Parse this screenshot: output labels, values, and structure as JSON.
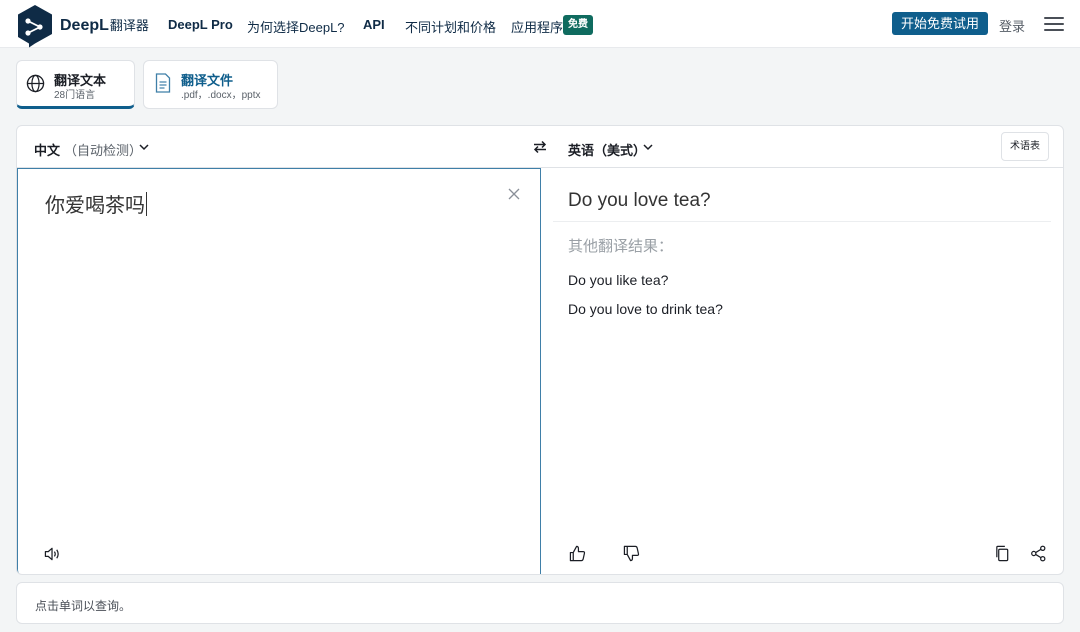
{
  "header": {
    "brand": "DeepL",
    "brand_sub": "翻译器",
    "nav": [
      "DeepL Pro",
      "为何选择DeepL?",
      "API",
      "不同计划和价格",
      "应用程序"
    ],
    "badge": "免费",
    "cta": "开始免费试用",
    "login": "登录"
  },
  "modes": {
    "text": {
      "title": "翻译文本",
      "subtitle": "28门语言"
    },
    "file": {
      "title": "翻译文件",
      "subtitle": ".pdf，.docx，pptx"
    }
  },
  "translator": {
    "source_lang": "中文",
    "source_lang_note": "（自动检测）",
    "target_lang": "英语（美式）",
    "glossary": "术语表",
    "source_text": "你爱喝茶吗",
    "target_text": "Do you love tea?",
    "alternatives_title": "其他翻译结果：",
    "alternatives": [
      "Do you like tea?",
      "Do you love to drink tea?"
    ]
  },
  "footer": {
    "hint": "点击单词以查询。"
  },
  "colors": {
    "primary": "#0f5e8c",
    "navy": "#0f2b46",
    "badge": "#0f6b5f"
  }
}
